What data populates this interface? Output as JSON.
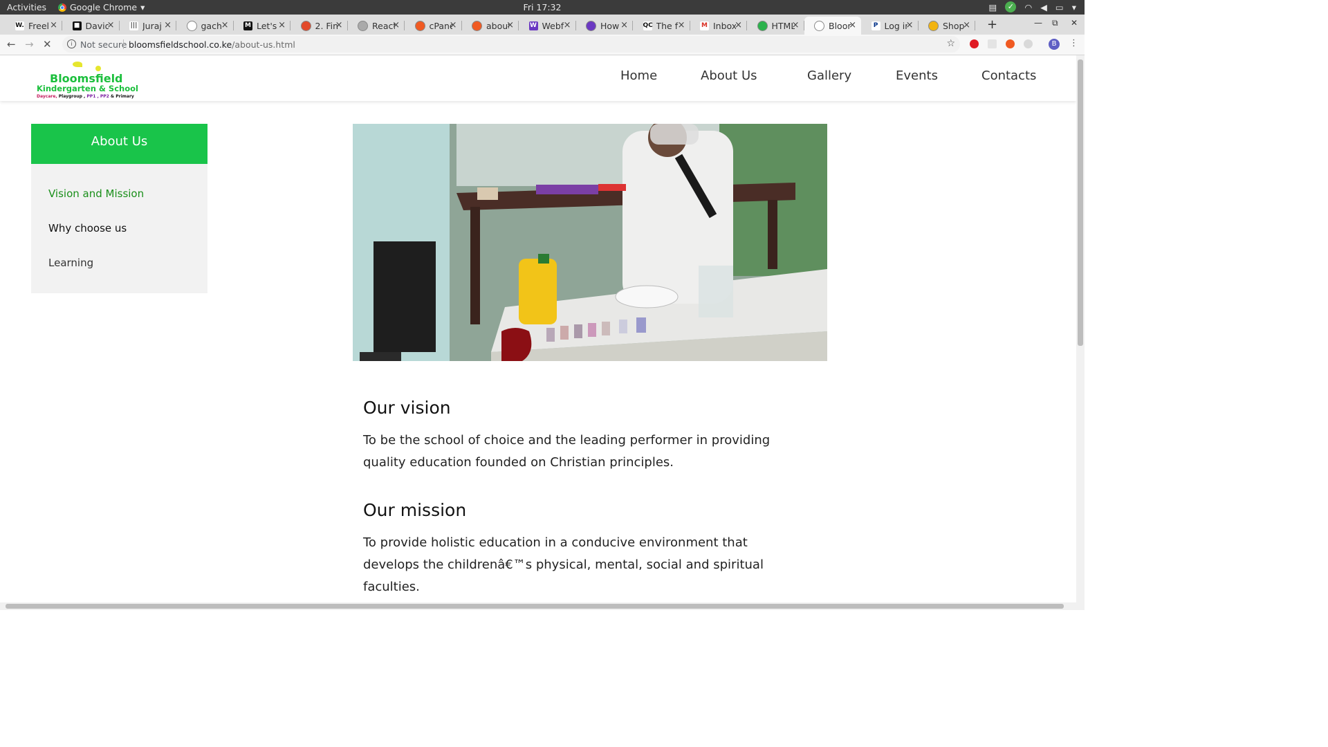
{
  "system_bar": {
    "activities": "Activities",
    "app_name": "Google Chrome",
    "clock": "Fri 17:32"
  },
  "browser": {
    "tabs": [
      {
        "title": "Freel",
        "favicon": "W.",
        "active": false
      },
      {
        "title": "David",
        "favicon": "■",
        "active": false
      },
      {
        "title": "Juraj",
        "favicon": "|||",
        "active": false
      },
      {
        "title": "gach",
        "favicon": "github-icon",
        "active": false
      },
      {
        "title": "Let's",
        "favicon": "M",
        "active": false
      },
      {
        "title": "2. Fin",
        "favicon": "figma-icon",
        "active": false
      },
      {
        "title": "React",
        "favicon": "tab-icon",
        "active": false
      },
      {
        "title": "cPane",
        "favicon": "cpanel-icon",
        "active": false
      },
      {
        "title": "about",
        "favicon": "cpanel-icon",
        "active": false
      },
      {
        "title": "Webf",
        "favicon": "W",
        "active": false
      },
      {
        "title": "How",
        "favicon": "chat-icon",
        "active": false
      },
      {
        "title": "The f",
        "favicon": "QC",
        "active": false
      },
      {
        "title": "Inbox",
        "favicon": "M",
        "active": false
      },
      {
        "title": "HTML",
        "favicon": "html-icon",
        "active": false
      },
      {
        "title": "Bloor",
        "favicon": "loading-icon",
        "active": true
      },
      {
        "title": "Log in",
        "favicon": "P",
        "active": false
      },
      {
        "title": "Shop",
        "favicon": "shop-icon",
        "active": false
      }
    ],
    "new_tab": "+",
    "security_label": "Not secure",
    "url_host": "bloomsfieldschool.co.ke",
    "url_path": "/about-us.html"
  },
  "site": {
    "logo": {
      "name": "Bloomsfield",
      "subtitle": "Kindergarten & School",
      "tagline_daycare": "Daycare,",
      "tagline_playgroup": "Playgroup ,",
      "tagline_pp": "PP1 , PP2",
      "tagline_primary": "& Primary"
    },
    "nav": [
      "Home",
      "About Us",
      "Gallery",
      "Events",
      "Contacts"
    ],
    "sidebar": {
      "title": "About Us",
      "items": [
        "Vision and Mission",
        "Why choose us",
        "Learning"
      ]
    },
    "vision_heading": "Our vision",
    "vision_text": "To be the school of choice and the leading performer in providing quality education founded on Christian principles.",
    "mission_heading": "Our mission",
    "mission_text": "To provide holistic education in a conducive environment that develops the childrenâ€™s physical, mental, social and spiritual faculties."
  },
  "colors": {
    "brand_green": "#19c44a",
    "active_link": "#1a8f1a"
  }
}
